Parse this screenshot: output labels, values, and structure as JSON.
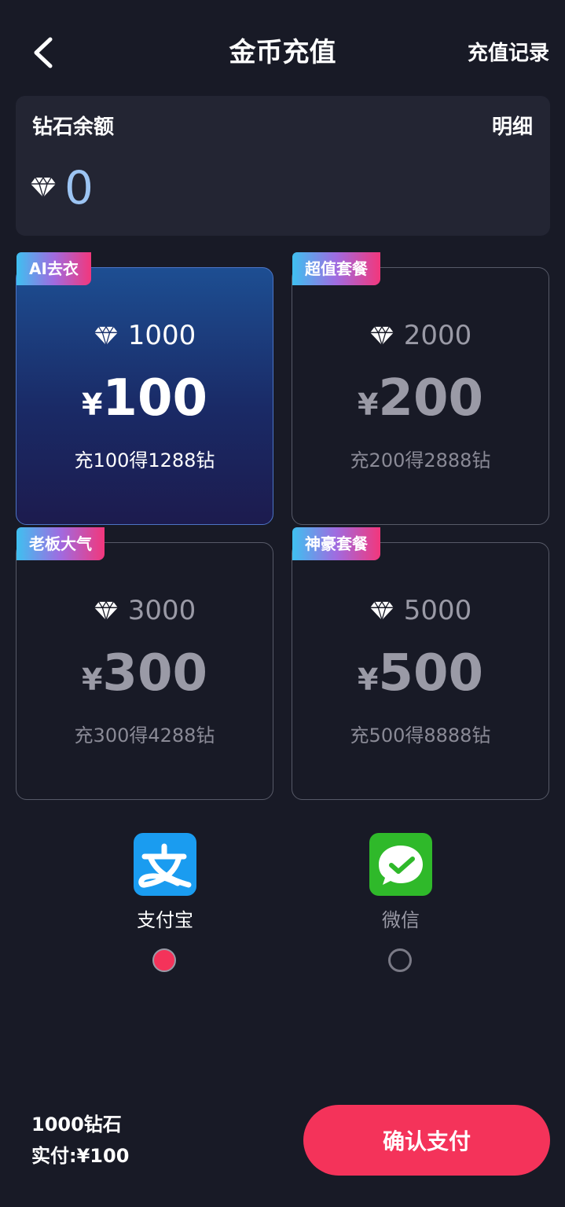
{
  "header": {
    "title": "金币充值",
    "records_label": "充值记录"
  },
  "balance": {
    "label": "钻石余额",
    "detail_label": "明细",
    "value": "0"
  },
  "packages": [
    {
      "tag": "AI去衣",
      "amount": "1000",
      "currency": "¥",
      "price": "100",
      "bonus": "充100得1288钻",
      "selected": true
    },
    {
      "tag": "超值套餐",
      "amount": "2000",
      "currency": "¥",
      "price": "200",
      "bonus": "充200得2888钻",
      "selected": false
    },
    {
      "tag": "老板大气",
      "amount": "3000",
      "currency": "¥",
      "price": "300",
      "bonus": "充300得4288钻",
      "selected": false
    },
    {
      "tag": "神豪套餐",
      "amount": "5000",
      "currency": "¥",
      "price": "500",
      "bonus": "充500得8888钻",
      "selected": false
    }
  ],
  "payment": {
    "methods": [
      {
        "label": "支付宝",
        "icon": "alipay-icon",
        "color": "#1a9cf0",
        "selected": true
      },
      {
        "label": "微信",
        "icon": "wechat-icon",
        "color": "#2fb92a",
        "selected": false
      }
    ]
  },
  "summary": {
    "diamonds": "1000钻石",
    "paid": "实付:¥100"
  },
  "confirm_label": "确认支付",
  "colors": {
    "background": "#181a26",
    "accent": "#f4335a",
    "balance_value": "#9cc4f3"
  }
}
